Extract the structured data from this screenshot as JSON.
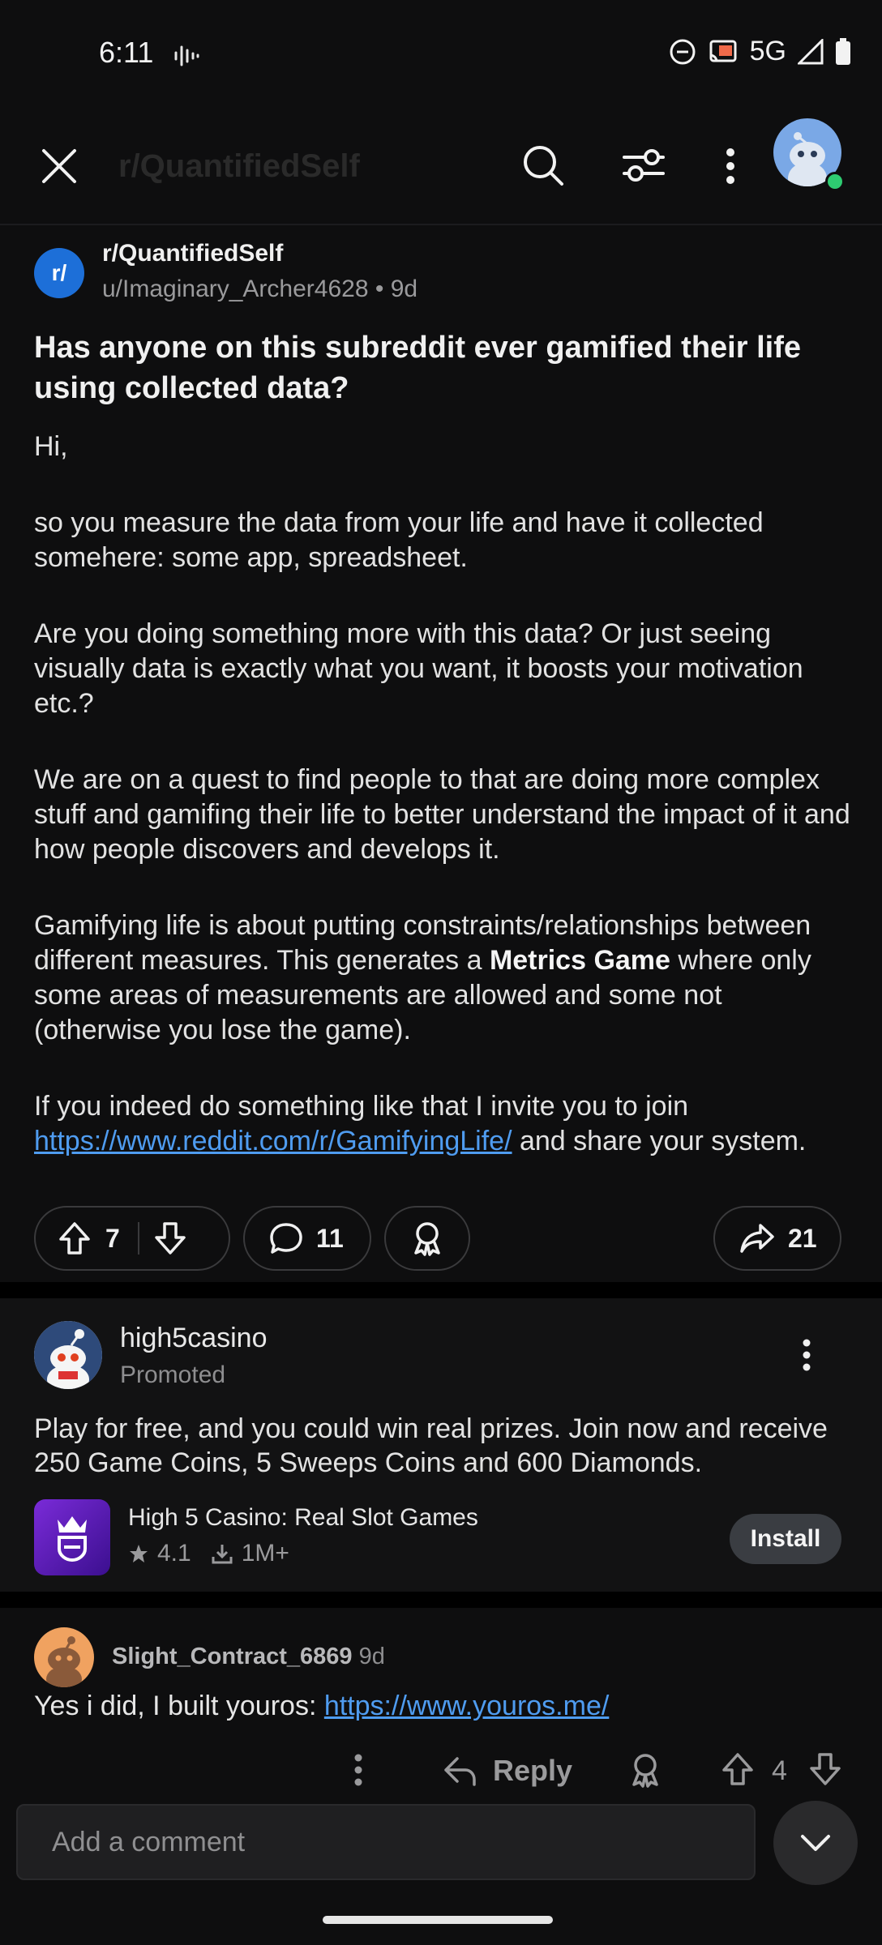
{
  "status_bar": {
    "time": "6:11",
    "network": "5G"
  },
  "top_bar": {
    "title": "r/QuantifiedSelf"
  },
  "post": {
    "subreddit": "r/QuantifiedSelf",
    "sub_icon_text": "r/",
    "author": "u/Imaginary_Archer4628",
    "age": "9d",
    "title": "Has anyone on this subreddit ever gamified their life using collected data?",
    "body": {
      "p1": "Hi,",
      "p2": "so you measure the data from your life and have it collected somehere: some app, spreadsheet.",
      "p3": "Are you doing something more with this data? Or just seeing visually data is exactly what you want, it boosts your motivation etc.?",
      "p4": "We are on a quest to find people to that are doing more complex stuff and gamifing their life to better understand the impact of it and how people discovers and develops it.",
      "p5_a": "Gamifying life is about putting constraints/relationships between different measures. This generates a ",
      "p5_bold": "Metrics Game",
      "p5_b": " where only some areas of measurements are allowed and some not (otherwise you lose the game).",
      "p6_a": "If you indeed do something like that I invite you to join ",
      "p6_link": "https://www.reddit.com/r/GamifyingLife/",
      "p6_b": " and share your system."
    },
    "votes": "7",
    "comments": "11",
    "shares": "21"
  },
  "ad": {
    "advertiser": "high5casino",
    "label": "Promoted",
    "text": "Play for free, and you could win real prizes. Join now and receive 250 Game Coins, 5 Sweeps Coins and 600 Diamonds.",
    "app_name": "High 5 Casino: Real Slot Games",
    "rating": "4.1",
    "downloads": "1M+",
    "install_label": "Install"
  },
  "comment": {
    "author": "Slight_Contract_6869",
    "age": "9d",
    "text": "Yes i did, I built youros: ",
    "link": "https://www.youros.me/",
    "reply_label": "Reply",
    "votes": "4"
  },
  "bottom": {
    "placeholder": "Add a comment"
  },
  "colors": {
    "background": "#0e0e0f",
    "link": "#4f9cf0",
    "sub_icon": "#1d6fd8",
    "online": "#2ecc71"
  }
}
